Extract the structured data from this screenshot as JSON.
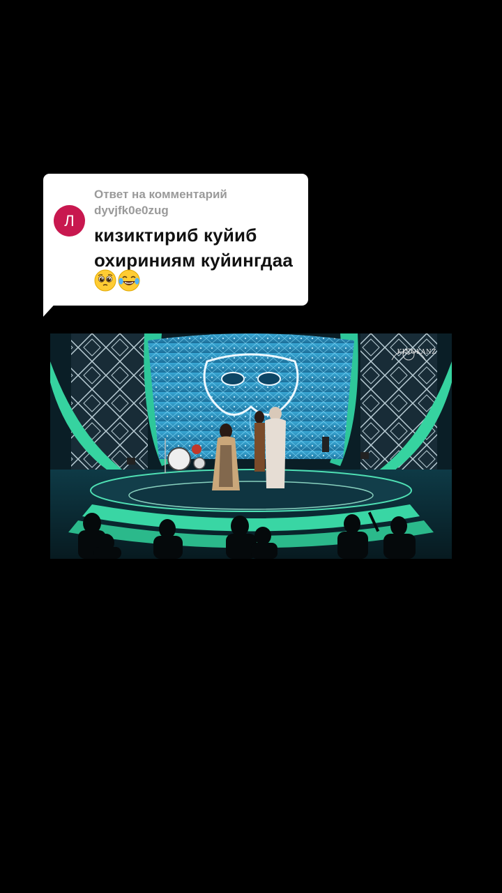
{
  "reply": {
    "header": "Ответ на комментарий",
    "username": "dyvjfk0e0zug",
    "avatar_letter": "Л",
    "avatar_color": "#c8184f",
    "text": "кизиктириб куйиб охириниям куйингдаа",
    "emojis": [
      "pleading-face-icon",
      "tears-of-joy-icon"
    ]
  },
  "video": {
    "watermark": "KINOKANZ"
  }
}
